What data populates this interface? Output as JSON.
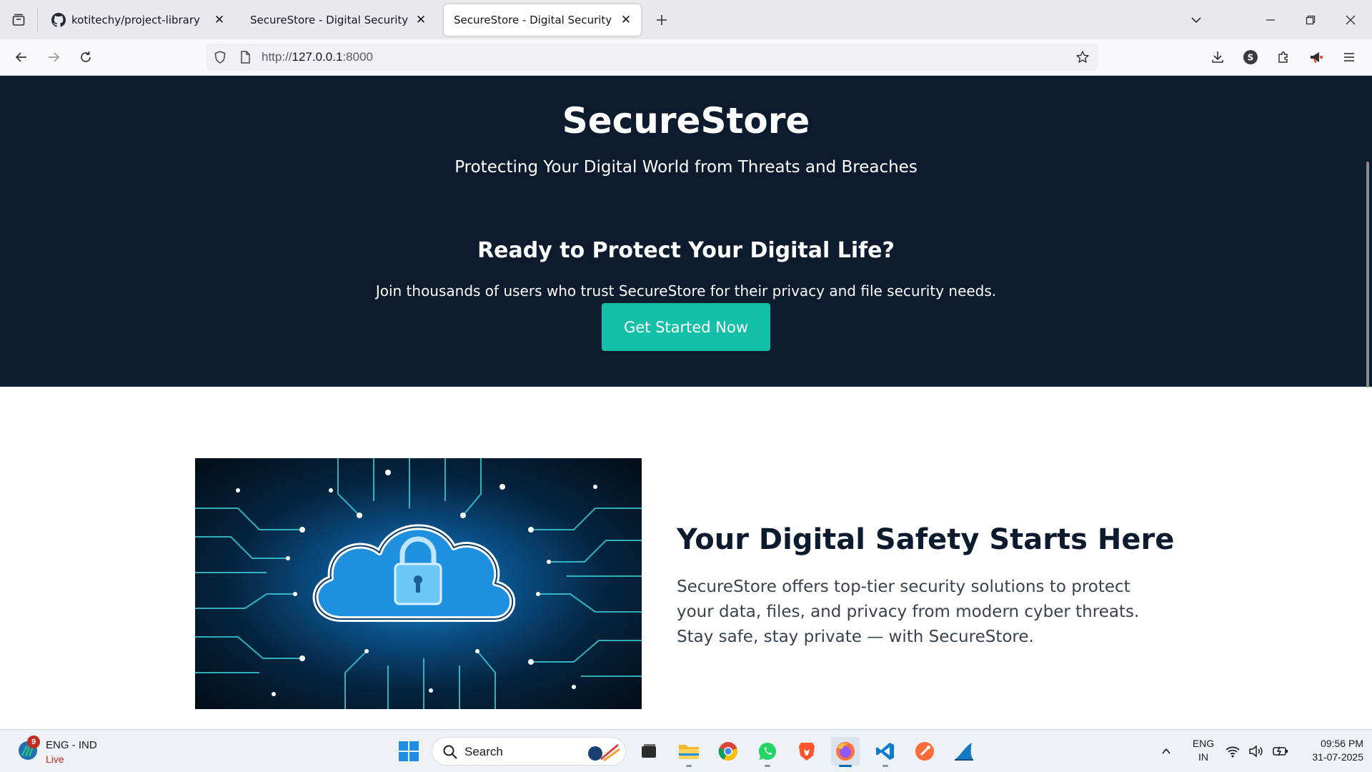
{
  "browser": {
    "tabs": [
      {
        "title": "kotitechy/project-library",
        "favicon": "github-icon",
        "active": false
      },
      {
        "title": "SecureStore - Digital Security Simplified",
        "favicon": "none",
        "active": false
      },
      {
        "title": "SecureStore - Digital Security Simplified",
        "favicon": "none",
        "active": true
      }
    ],
    "url": {
      "scheme": "http://",
      "host": "127.0.0.1",
      "port": ":8000"
    }
  },
  "hero": {
    "title": "SecureStore",
    "subtitle": "Protecting Your Digital World from Threats and Breaches",
    "cta_heading": "Ready to Protect Your Digital Life?",
    "cta_text": "Join thousands of users who trust SecureStore for their privacy and file security needs.",
    "cta_button": "Get Started Now"
  },
  "about": {
    "heading": "Your Digital Safety Starts Here",
    "body": "SecureStore offers top-tier security solutions to protect your data, files, and privacy from modern cyber threats. Stay safe, stay private — with SecureStore."
  },
  "taskbar": {
    "weather": {
      "badge": "9",
      "line1": "ENG - IND",
      "line2": "Live"
    },
    "search_placeholder": "Search",
    "apps": [
      "task-view",
      "file-explorer",
      "chrome",
      "whatsapp",
      "brave",
      "firefox",
      "vscode",
      "postman",
      "wireshark"
    ],
    "language": {
      "line1": "ENG",
      "line2": "IN"
    },
    "clock": {
      "time": "09:56 PM",
      "date": "31-07-2025"
    }
  },
  "colors": {
    "hero_bg": "#0d1b2e",
    "accent": "#13bfa6",
    "heading": "#0d1b2e",
    "body_text": "#3a4250"
  }
}
